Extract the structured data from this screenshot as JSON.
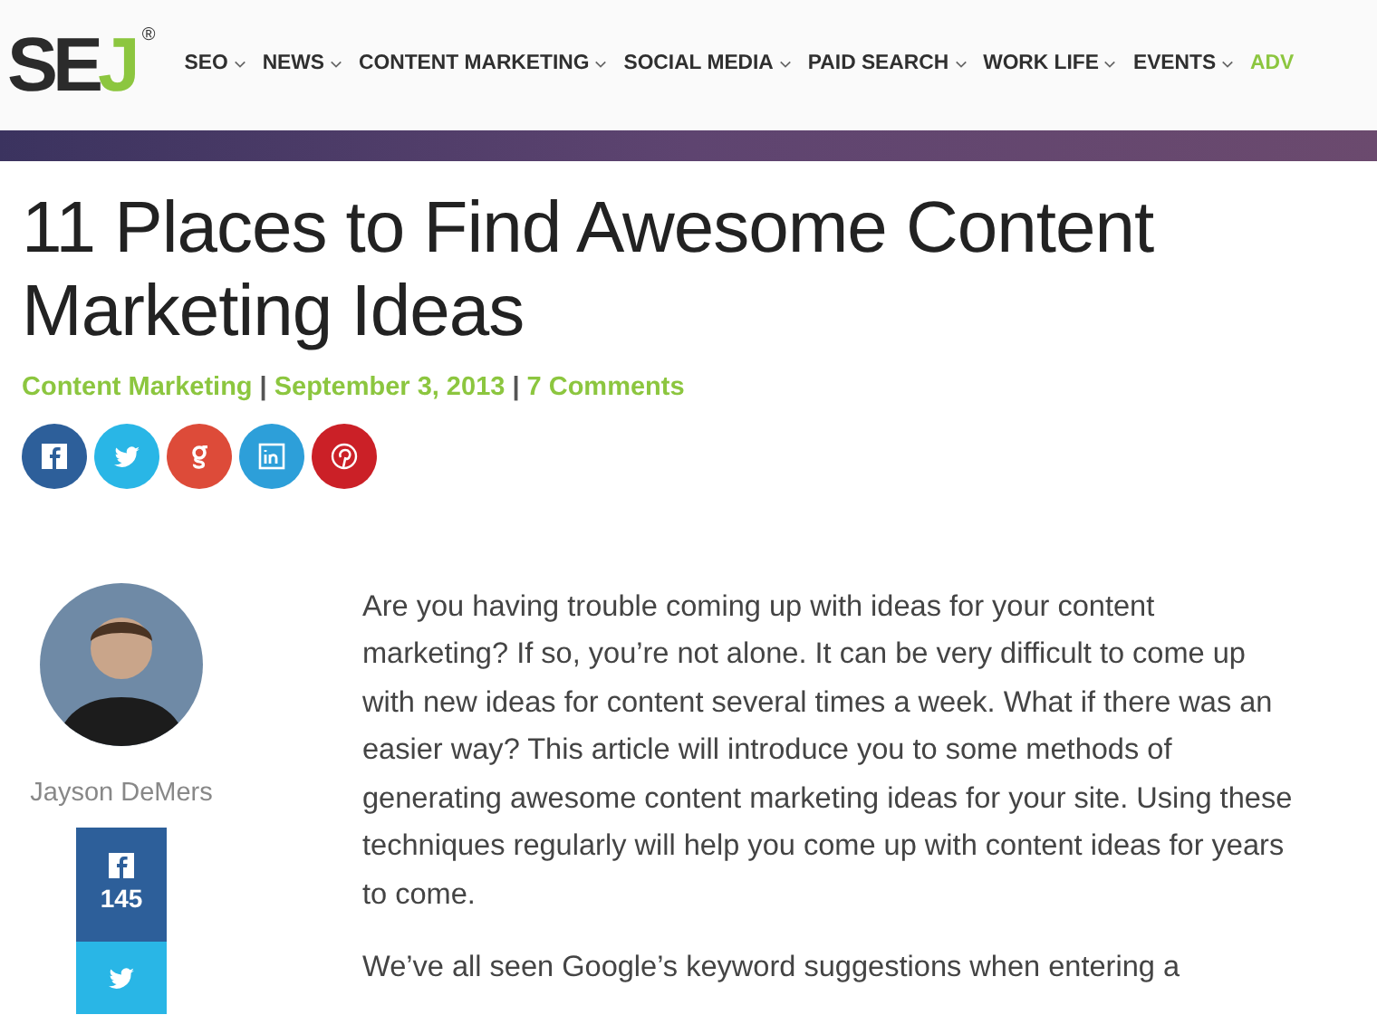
{
  "logo": {
    "letters": "SE",
    "accent": "J",
    "mark": "®"
  },
  "nav": [
    {
      "label": "SEO",
      "color": "#2f2f2f",
      "dropdown": true
    },
    {
      "label": "NEWS",
      "color": "#2f2f2f",
      "dropdown": true
    },
    {
      "label": "CONTENT MARKETING",
      "color": "#2f2f2f",
      "dropdown": true
    },
    {
      "label": "SOCIAL MEDIA",
      "color": "#2f2f2f",
      "dropdown": true
    },
    {
      "label": "PAID SEARCH",
      "color": "#2f2f2f",
      "dropdown": true
    },
    {
      "label": "WORK LIFE",
      "color": "#2f2f2f",
      "dropdown": true
    },
    {
      "label": "EVENTS",
      "color": "#2f2f2f",
      "dropdown": true
    },
    {
      "label": "ADV",
      "color": "#8cc63f",
      "dropdown": false
    }
  ],
  "article": {
    "title": "11 Places to Find Awesome Content Marketing Ideas",
    "meta": [
      {
        "kind": "link",
        "text": "Content Marketing"
      },
      {
        "kind": "sep",
        "text": "|"
      },
      {
        "kind": "link",
        "text": "September 3, 2013"
      },
      {
        "kind": "sep",
        "text": "|"
      },
      {
        "kind": "link",
        "text": "7 Comments"
      }
    ],
    "share": [
      {
        "kind": "facebook",
        "color": "#2d5f9a"
      },
      {
        "kind": "twitter",
        "color": "#29b6e6"
      },
      {
        "kind": "google",
        "color": "#dd4b39"
      },
      {
        "kind": "linkedin",
        "color": "#2d9fd9"
      },
      {
        "kind": "pinterest",
        "color": "#cb2027"
      }
    ],
    "author": {
      "name": "Jayson DeMers"
    },
    "side_share": [
      {
        "kind": "facebook",
        "color": "#2d5f9a",
        "count": "145"
      },
      {
        "kind": "twitter",
        "color": "#29b6e6"
      }
    ],
    "paragraphs": [
      "Are you having trouble coming up with ideas for your content marketing? If so, you’re not alone. It can be very difficult to come up with new ideas for content several times a week. What if there was an easier way? This article will introduce you to some methods of generating awesome content marketing ideas for your site. Using these techniques regularly will help you come up with content ideas for years to come.",
      "We’ve all seen Google’s keyword suggestions when entering a"
    ]
  }
}
